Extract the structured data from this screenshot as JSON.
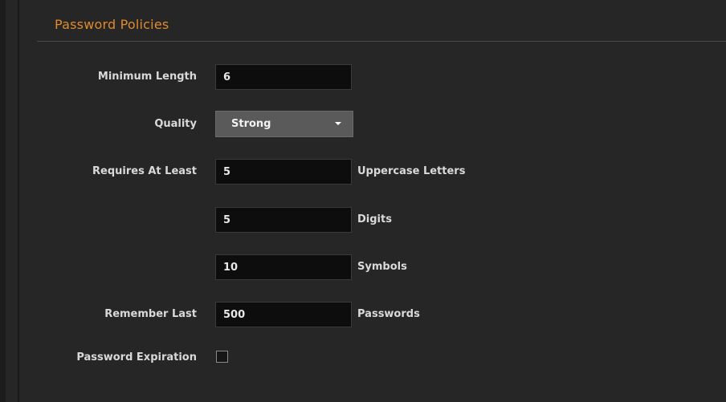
{
  "section": {
    "title": "Password Policies"
  },
  "form": {
    "min_length": {
      "label": "Minimum Length",
      "value": "6"
    },
    "quality": {
      "label": "Quality",
      "selected": "Strong"
    },
    "requires_at_least": {
      "label": "Requires At Least",
      "uppercase": {
        "value": "5",
        "suffix": "Uppercase Letters"
      },
      "digits": {
        "value": "5",
        "suffix": "Digits"
      },
      "symbols": {
        "value": "10",
        "suffix": "Symbols"
      }
    },
    "remember_last": {
      "label": "Remember Last",
      "value": "500",
      "suffix": "Passwords"
    },
    "password_expiration": {
      "label": "Password Expiration",
      "checked": false
    }
  },
  "colors": {
    "background": "#262626",
    "accent_title": "#e08a2c",
    "input_bg": "#0d0d0d",
    "select_bg": "#5a5a5a"
  },
  "icons": {
    "select_caret": "chevron-down-icon",
    "checkbox": "checkbox-unchecked-icon"
  }
}
